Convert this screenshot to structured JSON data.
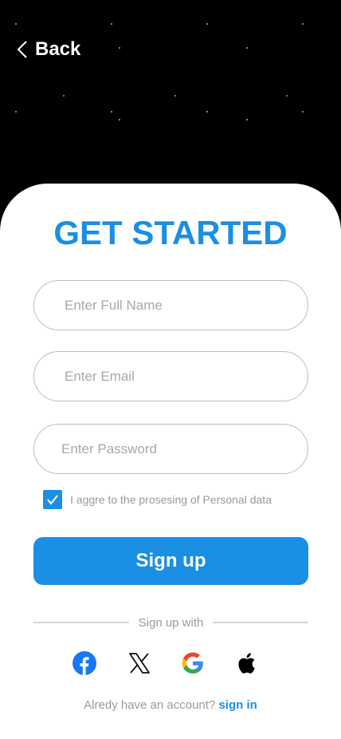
{
  "header": {
    "back_label": "Back"
  },
  "form": {
    "title": "GET STARTED",
    "full_name_placeholder": "Enter Full Name",
    "email_placeholder": "Enter Email",
    "password_placeholder": "Enter Password",
    "agree_label": "I aggre to the prosesing of Personal data",
    "agree_checked": true,
    "signup_label": "Sign up"
  },
  "social": {
    "divider_label": "Sign up with",
    "providers": [
      "facebook-icon",
      "x-icon",
      "google-icon",
      "apple-icon"
    ]
  },
  "footer": {
    "question": "Alredy have an account?",
    "signin_label": "sign in"
  },
  "colors": {
    "accent": "#1a8fe3",
    "background": "#000000",
    "card": "#ffffff"
  }
}
